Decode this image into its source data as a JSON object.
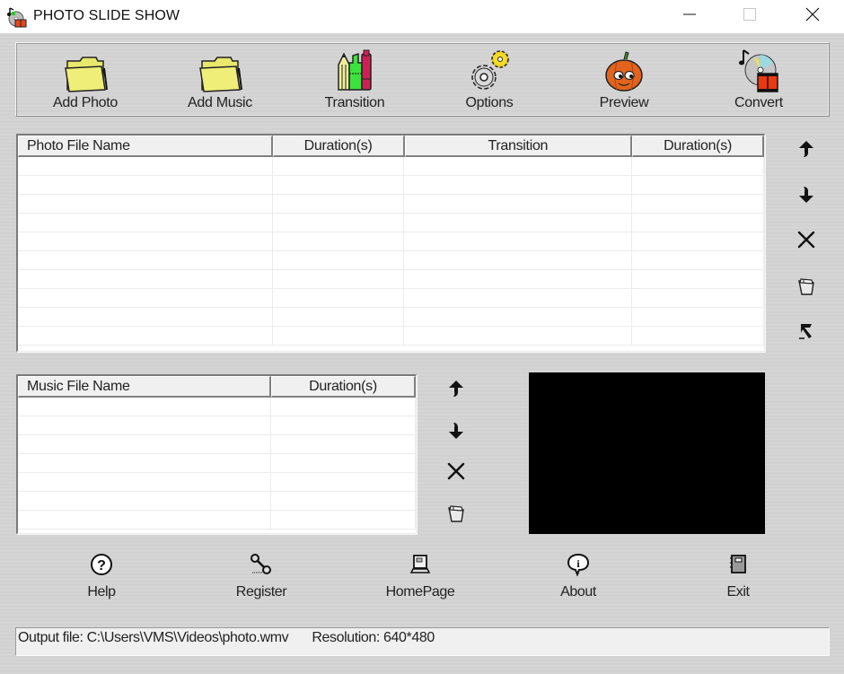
{
  "window": {
    "title": "PHOTO SLIDE SHOW",
    "app_icon": "film-music-icon",
    "controls": {
      "minimize": "minimize-icon",
      "maximize": "maximize-icon",
      "close": "close-icon"
    }
  },
  "toolbar": {
    "buttons": [
      {
        "label": "Add Photo",
        "icon": "folder-icon"
      },
      {
        "label": "Add Music",
        "icon": "folder-icon"
      },
      {
        "label": "Transition",
        "icon": "pencils-icon"
      },
      {
        "label": "Options",
        "icon": "gears-icon"
      },
      {
        "label": "Preview",
        "icon": "pumpkin-icon"
      },
      {
        "label": "Convert",
        "icon": "disc-film-icon"
      }
    ]
  },
  "photo_list": {
    "columns": [
      "Photo File Name",
      "Duration(s)",
      "Transition",
      "Duration(s)"
    ],
    "rows": [],
    "side_buttons": [
      {
        "name": "move-up",
        "icon": "arrow-up-icon"
      },
      {
        "name": "move-down",
        "icon": "arrow-down-icon"
      },
      {
        "name": "delete",
        "icon": "x-icon"
      },
      {
        "name": "clear-all",
        "icon": "trash-icon"
      },
      {
        "name": "edit",
        "icon": "hammer-icon"
      }
    ]
  },
  "music_list": {
    "columns": [
      "Music File Name",
      "Duration(s)"
    ],
    "rows": [],
    "side_buttons": [
      {
        "name": "move-up",
        "icon": "arrow-up-icon"
      },
      {
        "name": "move-down",
        "icon": "arrow-down-icon"
      },
      {
        "name": "delete",
        "icon": "x-icon"
      },
      {
        "name": "clear-all",
        "icon": "trash-icon"
      }
    ]
  },
  "preview": {
    "color": "#000000"
  },
  "bottom_bar": {
    "buttons": [
      {
        "label": "Help",
        "icon": "help-icon"
      },
      {
        "label": "Register",
        "icon": "key-icon"
      },
      {
        "label": "HomePage",
        "icon": "computer-icon"
      },
      {
        "label": "About",
        "icon": "info-bubble-icon"
      },
      {
        "label": "Exit",
        "icon": "exit-book-icon"
      }
    ]
  },
  "status": {
    "output_file": "Output file: C:\\Users\\VMS\\Videos\\photo.wmv",
    "resolution": "Resolution: 640*480"
  }
}
